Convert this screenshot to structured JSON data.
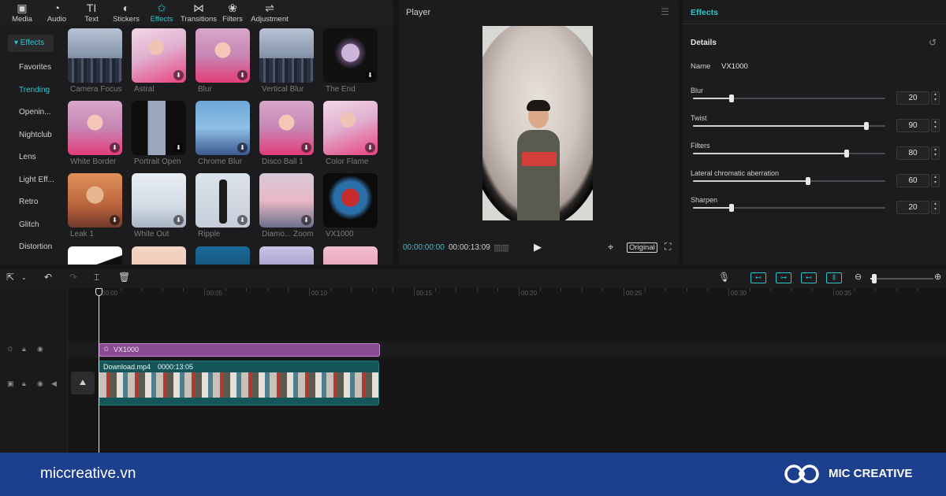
{
  "media_tabs": [
    {
      "label": "Media",
      "icon": "media-icon",
      "glyph": "▣"
    },
    {
      "label": "Audio",
      "icon": "audio-icon",
      "glyph": "◔"
    },
    {
      "label": "Text",
      "icon": "text-icon",
      "glyph": "TI"
    },
    {
      "label": "Stickers",
      "icon": "stickers-icon",
      "glyph": "◐"
    },
    {
      "label": "Effects",
      "icon": "effects-icon",
      "glyph": "✩"
    },
    {
      "label": "Transitions",
      "icon": "transitions-icon",
      "glyph": "⋈"
    },
    {
      "label": "Filters",
      "icon": "filters-icon",
      "glyph": "❀"
    },
    {
      "label": "Adjustment",
      "icon": "adjustment-icon",
      "glyph": "⇌"
    }
  ],
  "active_tab": "Effects",
  "sidebar": {
    "category": "▾ Effects",
    "items": [
      "Favorites",
      "Trending",
      "Openin...",
      "Nightclub",
      "Lens",
      "Light Eff...",
      "Retro",
      "Glitch",
      "Distortion"
    ],
    "selected": "Trending"
  },
  "effects_grid": [
    {
      "label": "Camera Focus"
    },
    {
      "label": "Astral"
    },
    {
      "label": "Blur"
    },
    {
      "label": "Vertical Blur"
    },
    {
      "label": "The End"
    },
    {
      "label": "White Border"
    },
    {
      "label": "Portrait Open"
    },
    {
      "label": "Chrome Blur"
    },
    {
      "label": "Disco Ball 1"
    },
    {
      "label": "Color Flame"
    },
    {
      "label": "Leak 1"
    },
    {
      "label": "White Out"
    },
    {
      "label": "Ripple"
    },
    {
      "label": "Diamo... Zoom"
    },
    {
      "label": "VX1000"
    }
  ],
  "player": {
    "title": "Player",
    "current_time": "00:00:00:00",
    "total_time": "00:00:13:09",
    "ratio_label": "Original"
  },
  "details": {
    "header": "Effects",
    "section": "Details",
    "name_label": "Name",
    "name_value": "VX1000",
    "params": [
      {
        "label": "Blur",
        "value": "20",
        "level": 0.2
      },
      {
        "label": "Twist",
        "value": "90",
        "level": 0.9
      },
      {
        "label": "Filters",
        "value": "80",
        "level": 0.8
      },
      {
        "label": "Lateral chromatic aberration",
        "value": "60",
        "level": 0.6
      },
      {
        "label": "Sharpen",
        "value": "20",
        "level": 0.2
      }
    ]
  },
  "timeline": {
    "ruler_labels": [
      "00:00",
      "00:05",
      "00:10",
      "00:15",
      "00:20",
      "00:25",
      "00:30",
      "00:35"
    ],
    "effect_clip": "VX1000",
    "video_clip_name": "Download.mp4",
    "video_clip_duration": "0000:13:05"
  },
  "footer": {
    "site": "miccreative.vn",
    "brand": "MIC CREATIVE"
  },
  "colors": {
    "accent": "#2ec4cc",
    "effect_clip": "#8a4a93",
    "video_clip": "#14565a",
    "footer_bg": "#1c3f8e"
  }
}
